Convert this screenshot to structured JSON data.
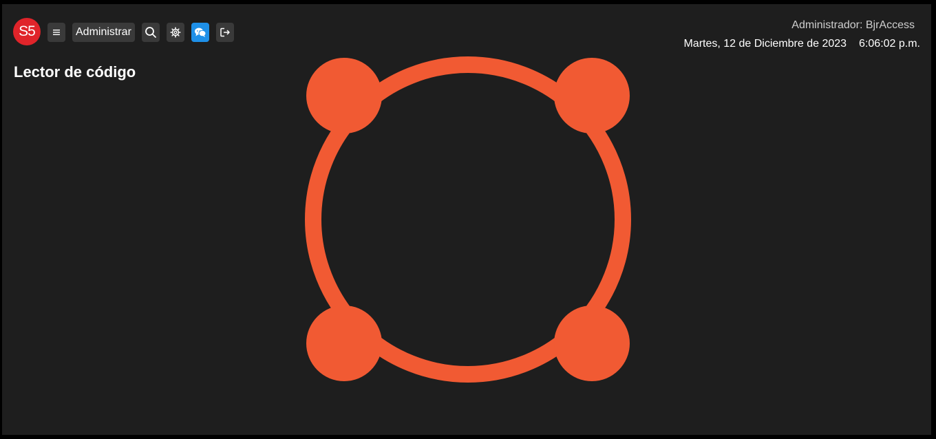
{
  "app": {
    "logo_text": "S5",
    "page_title": "Lector de código"
  },
  "toolbar": {
    "menu_icon": "hamburger-menu-icon",
    "admin_label": "Administrar",
    "search_icon": "search-icon",
    "settings_icon": "gear-icon",
    "chat_icon": "chat-bubbles-icon",
    "logout_icon": "logout-icon"
  },
  "header": {
    "user_label": "Administrador: BjrAccess",
    "date": "Martes, 12 de Diciembre de 2023",
    "time": "6:06:02 p.m."
  },
  "loader": {
    "icon": "loading-spinner-icon",
    "color": "#f15a33"
  },
  "colors": {
    "background": "#1e1e1e",
    "logo": "#e0242a",
    "accent": "#1e90e8",
    "button": "#3a3a3a"
  }
}
